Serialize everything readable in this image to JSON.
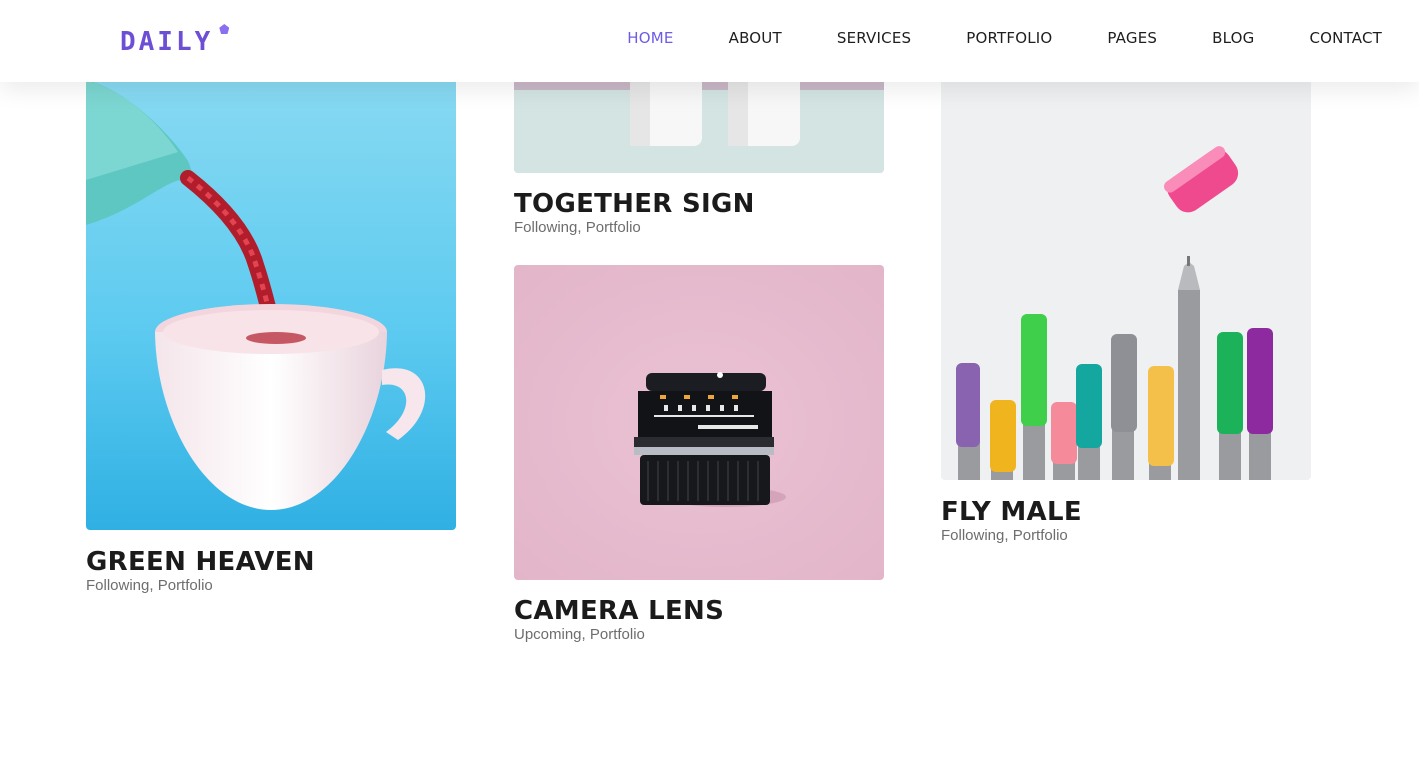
{
  "brand": {
    "logo_text": "DAILY"
  },
  "nav": {
    "items": [
      {
        "label": "HOME",
        "active": true
      },
      {
        "label": "ABOUT",
        "active": false
      },
      {
        "label": "SERVICES",
        "active": false
      },
      {
        "label": "PORTFOLIO",
        "active": false
      },
      {
        "label": "PAGES",
        "active": false
      },
      {
        "label": "BLOG",
        "active": false
      },
      {
        "label": "CONTACT",
        "active": false
      }
    ]
  },
  "colors": {
    "accent": "#6c5ce7",
    "text": "#1b1b1b",
    "muted": "#6d6d6d"
  },
  "portfolio": [
    {
      "title": "GREEN HEAVEN",
      "status": "Following",
      "category": "Portfolio",
      "image": "teapot-pouring-red-liquid-into-cup"
    },
    {
      "title": "TOGETHER SIGN",
      "status": "Following",
      "category": "Portfolio",
      "image": "white-cups-on-mint-background"
    },
    {
      "title": "CAMERA LENS",
      "status": "Upcoming",
      "category": "Portfolio",
      "image": "camera-lens-on-pink-background"
    },
    {
      "title": "FLY MALE",
      "status": "Following",
      "category": "Portfolio",
      "image": "colored-markers-on-white-background"
    }
  ]
}
